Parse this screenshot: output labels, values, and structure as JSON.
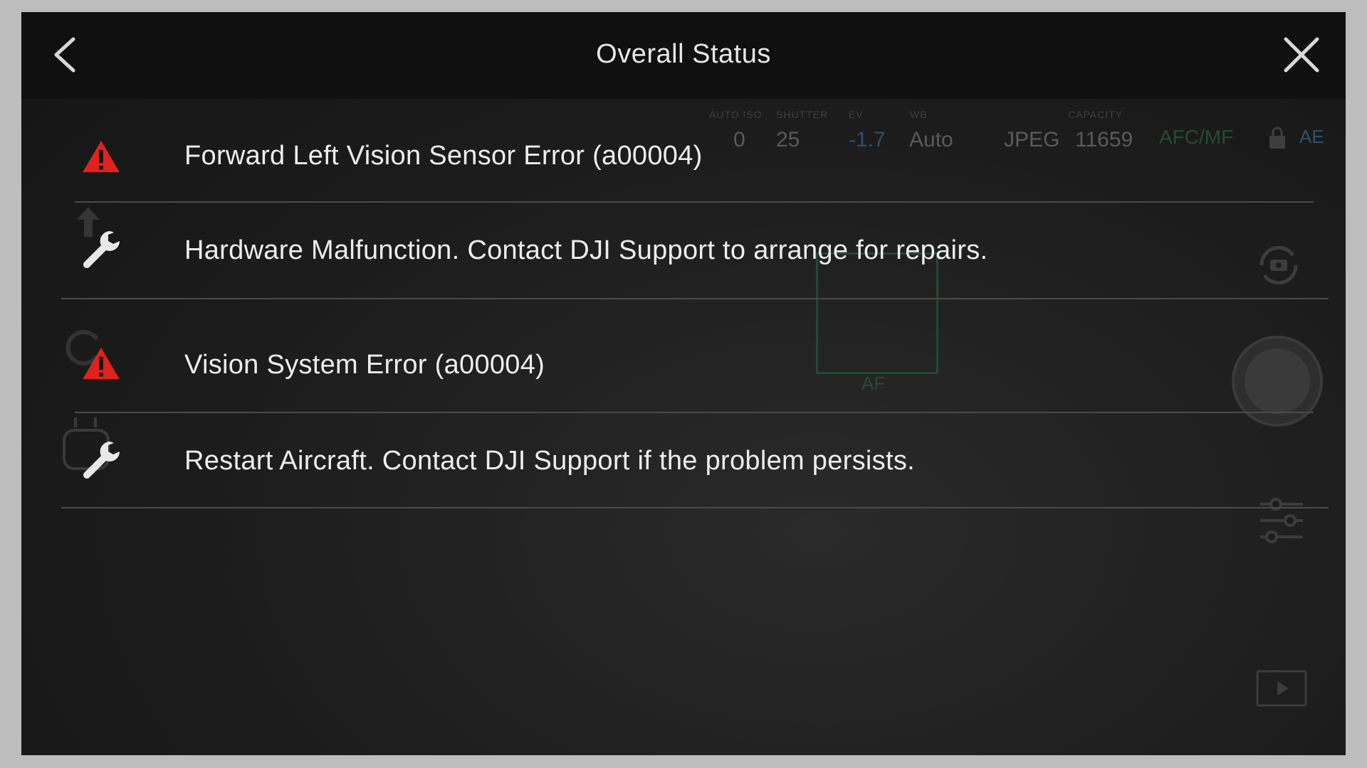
{
  "header": {
    "title": "Overall Status",
    "back_icon": "chevron-left-icon",
    "close_icon": "close-icon"
  },
  "status_items": [
    {
      "icon": "warning-icon",
      "text": "Forward Left Vision Sensor Error (a00004)"
    },
    {
      "icon": "wrench-icon",
      "text": "Hardware Malfunction. Contact DJI Support to arrange for repairs."
    },
    {
      "icon": "warning-icon",
      "text": "Vision System Error (a00004)"
    },
    {
      "icon": "wrench-icon",
      "text": "Restart Aircraft. Contact DJI Support if the problem persists."
    }
  ],
  "background_hud": {
    "iso_label": "AUTO ISO",
    "shutter_label": "SHUTTER",
    "ev_label": "EV",
    "wb_label": "WB",
    "capacity_label": "CAPACITY",
    "iso_value": "0",
    "shutter_value": "25",
    "ev_value": "-1.7",
    "wb_value": "Auto",
    "format_value": "JPEG",
    "capacity_value": "11659",
    "focus_mode": "AFC/MF",
    "ae_label": "AE",
    "af_label": "AF"
  },
  "colors": {
    "warning_red": "#e0221f",
    "text": "#ededed",
    "divider": "#4a4a4a",
    "header_bg": "#101010"
  }
}
